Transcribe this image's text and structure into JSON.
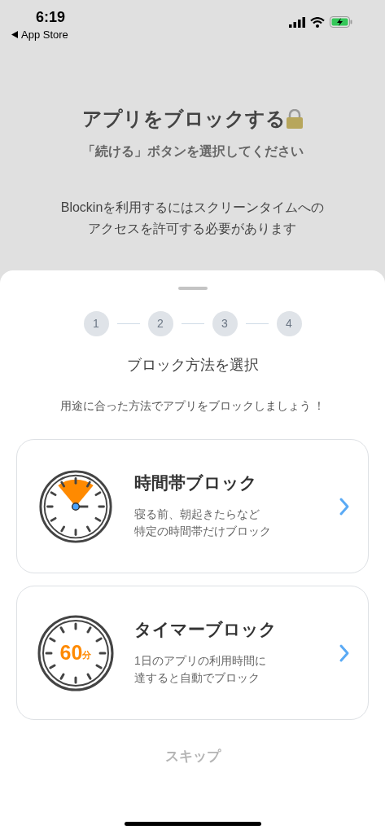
{
  "status_bar": {
    "time": "6:19",
    "back_label": "App Store"
  },
  "header": {
    "title": "アプリをブロックする",
    "subtitle": "「続ける」ボタンを選択してください",
    "message_lines": [
      "Blockinを利用するにはスクリーンタイムへの",
      "アクセスを許可する必要があります"
    ]
  },
  "sheet": {
    "steps": [
      {
        "label": "1",
        "selected": false
      },
      {
        "label": "2",
        "selected": false
      },
      {
        "label": "3",
        "selected": false
      },
      {
        "label": "4",
        "selected": false
      }
    ],
    "heading": "ブロック方法を選択",
    "description": "用途に合った方法でアプリをブロックしましょう ！",
    "options": [
      {
        "kind": "timeslot",
        "title": "時間帯ブロック",
        "lines": [
          "寝る前、朝起きたらなど",
          "特定の時間帯だけブロック"
        ]
      },
      {
        "kind": "timer",
        "title": "タイマーブロック",
        "timer_value": "60",
        "timer_unit": "分",
        "lines": [
          "1日のアプリの利用時間に",
          "達すると自動でブロック"
        ]
      }
    ],
    "skip": "スキップ"
  }
}
